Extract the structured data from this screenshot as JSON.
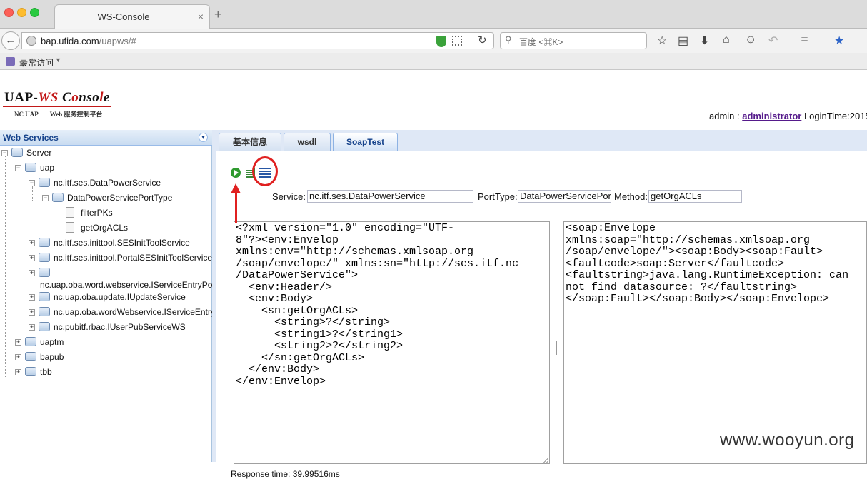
{
  "browser": {
    "tab_title": "WS-Console",
    "tab_close": "×",
    "new_tab": "+",
    "back": "←",
    "url_domain": "bap.ufida.com",
    "url_path": "/uapws/#",
    "reload": "↻",
    "search_icon": "⚲",
    "search_placeholder": "百度 <⌘K>",
    "bookmark_label": "最常访问",
    "bookmark_arrow": "▼",
    "toolbar_icons": [
      "star-icon",
      "reading-list-icon",
      "download-icon",
      "home-icon",
      "emoji-icon",
      "undo-icon",
      "crop-icon",
      "extension-icon"
    ],
    "toolbar_glyphs": [
      "☆",
      "▤",
      "⬇",
      "⌂",
      "☺",
      "↶",
      "⌗",
      "★"
    ]
  },
  "header": {
    "logo_prefix": "UAP-",
    "logo_ws": "WS",
    "logo_mid": " C",
    "logo_o": "o",
    "logo_suffix": "nso",
    "logo_l": "l",
    "logo_e": "e",
    "logo_sub_left": "NC UAP",
    "logo_sub_right": "Web 服务控制平台",
    "user_prefix": "admin : ",
    "user_name": "administrator",
    "user_suffix": " LoginTime:2015"
  },
  "left_panel": {
    "title": "Web Services",
    "collapse": "▾",
    "tree": [
      {
        "label": "Server",
        "toggle": "−"
      },
      {
        "label": "uap",
        "toggle": "−"
      },
      {
        "label": "nc.itf.ses.DataPowerService",
        "toggle": "−"
      },
      {
        "label": "DataPowerServicePortType",
        "toggle": "−"
      },
      {
        "label": "filterPKs"
      },
      {
        "label": "getOrgACLs"
      },
      {
        "label": "nc.itf.ses.inittool.SESInitToolService",
        "toggle": "+"
      },
      {
        "label": "nc.itf.ses.inittool.PortalSESInitToolService",
        "toggle": "+"
      },
      {
        "label": "",
        "toggle": "+"
      },
      {
        "label": "nc.uap.oba.word.webservice.IServiceEntryPoint"
      },
      {
        "label": "nc.uap.oba.update.IUpdateService",
        "toggle": "+"
      },
      {
        "label": "nc.uap.oba.wordWebservice.IServiceEntryPoint",
        "toggle": "+"
      },
      {
        "label": "nc.pubitf.rbac.IUserPubServiceWS",
        "toggle": "+"
      },
      {
        "label": "uaptm",
        "toggle": "+"
      },
      {
        "label": "bapub",
        "toggle": "+"
      },
      {
        "label": "tbb",
        "toggle": "+"
      }
    ]
  },
  "tabs": [
    "基本信息",
    "wsdl",
    "SoapTest"
  ],
  "soaptest": {
    "service_label": "Service:",
    "service_value": "nc.itf.ses.DataPowerService",
    "porttype_label": "PortType:",
    "porttype_value": "DataPowerServicePortType",
    "method_label": "Method:",
    "method_value": "getOrgACLs",
    "request": "<?xml version=\"1.0\" encoding=\"UTF-\n8\"?><env:Envelop\nxmlns:env=\"http://schemas.xmlsoap.org\n/soap/envelope/\" xmlns:sn=\"http://ses.itf.nc\n/DataPowerService\">\n  <env:Header/>\n  <env:Body>\n    <sn:getOrgACLs>\n      <string>?</string>\n      <string1>?</string1>\n      <string2>?</string2>\n    </sn:getOrgACLs>\n  </env:Body>\n</env:Envelop>",
    "response": "<soap:Envelope\nxmlns:soap=\"http://schemas.xmlsoap.org\n/soap/envelope/\"><soap:Body><soap:Fault>\n<faultcode>soap:Server</faultcode>\n<faultstring>java.lang.RuntimeException: can\nnot find datasource: ?</faultstring>\n</soap:Fault></soap:Body></soap:Envelope>",
    "response_time": "Response time: 39.99516ms"
  },
  "watermark": "www.wooyun.org"
}
